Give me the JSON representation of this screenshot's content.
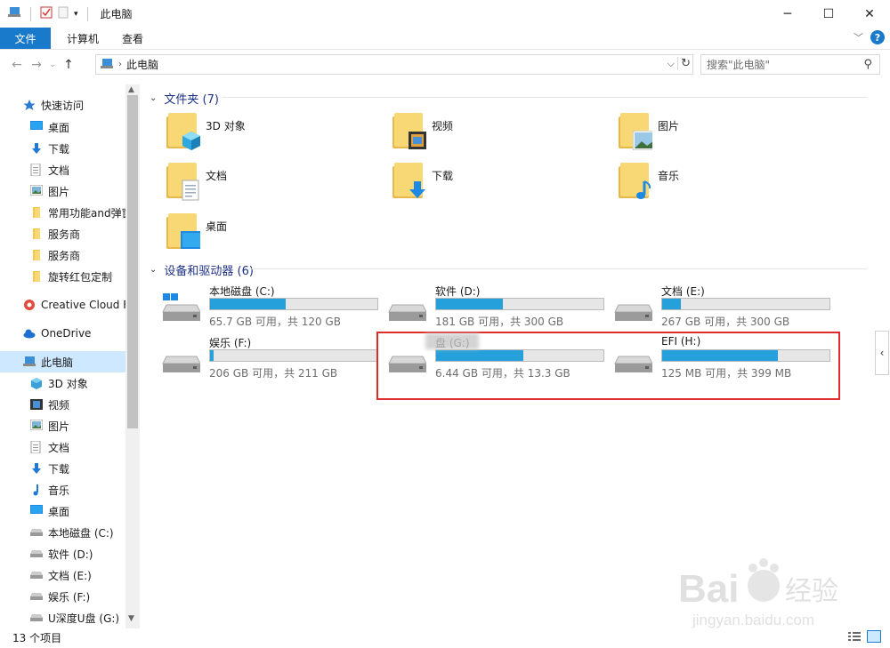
{
  "window": {
    "title": "此电脑",
    "controls": {
      "minimize": "─",
      "maximize": "☐",
      "close": "✕"
    }
  },
  "ribbon": {
    "tabs": [
      "文件",
      "计算机",
      "查看"
    ],
    "help": "?"
  },
  "address": {
    "path": "此电脑",
    "search_placeholder": "搜索\"此电脑\""
  },
  "nav": {
    "quick_access": "快速访问",
    "items": [
      {
        "label": "桌面",
        "icon": "desktop-icon",
        "pinned": true
      },
      {
        "label": "下载",
        "icon": "download-icon",
        "pinned": true
      },
      {
        "label": "文档",
        "icon": "document-icon",
        "pinned": true
      },
      {
        "label": "图片",
        "icon": "pictures-icon",
        "pinned": true
      },
      {
        "label": "常用功能and弹窗",
        "icon": "folder-icon"
      },
      {
        "label": "服务商",
        "icon": "folder-icon"
      },
      {
        "label": "服务商",
        "icon": "folder-icon"
      },
      {
        "label": "旋转红包定制",
        "icon": "folder-icon"
      }
    ],
    "creative_cloud": "Creative Cloud F",
    "onedrive": "OneDrive",
    "this_pc": "此电脑",
    "pc_items": [
      {
        "label": "3D 对象",
        "icon": "3d-objects-icon"
      },
      {
        "label": "视频",
        "icon": "video-icon"
      },
      {
        "label": "图片",
        "icon": "pictures-icon"
      },
      {
        "label": "文档",
        "icon": "document-icon"
      },
      {
        "label": "下载",
        "icon": "download-icon"
      },
      {
        "label": "音乐",
        "icon": "music-icon"
      },
      {
        "label": "桌面",
        "icon": "desktop-icon"
      },
      {
        "label": "本地磁盘 (C:)",
        "icon": "drive-icon"
      },
      {
        "label": "软件 (D:)",
        "icon": "drive-icon"
      },
      {
        "label": "文档 (E:)",
        "icon": "drive-icon"
      },
      {
        "label": "娱乐 (F:)",
        "icon": "drive-icon"
      },
      {
        "label": "U深度U盘 (G:)",
        "icon": "drive-icon"
      }
    ]
  },
  "folders_group": {
    "header": "文件夹 (7)",
    "items": [
      {
        "label": "3D 对象",
        "icon": "3d-objects-icon"
      },
      {
        "label": "视频",
        "icon": "video-icon"
      },
      {
        "label": "图片",
        "icon": "pictures-icon"
      },
      {
        "label": "文档",
        "icon": "document-icon"
      },
      {
        "label": "下载",
        "icon": "download-icon"
      },
      {
        "label": "音乐",
        "icon": "music-icon"
      },
      {
        "label": "桌面",
        "icon": "desktop-icon"
      }
    ]
  },
  "drives_group": {
    "header": "设备和驱动器 (6)",
    "items": [
      {
        "name": "本地磁盘 (C:)",
        "size_text": "65.7 GB 可用，共 120 GB",
        "used_fraction": 0.45,
        "windows": true
      },
      {
        "name": "软件 (D:)",
        "size_text": "181 GB 可用，共 300 GB",
        "used_fraction": 0.4
      },
      {
        "name": "文档 (E:)",
        "size_text": "267 GB 可用，共 300 GB",
        "used_fraction": 0.11
      },
      {
        "name": "娱乐 (F:)",
        "size_text": "206 GB 可用，共 211 GB",
        "used_fraction": 0.02
      },
      {
        "name": "盘 (G:)",
        "size_text": "6.44 GB 可用，共 13.3 GB",
        "used_fraction": 0.52
      },
      {
        "name": "EFI (H:)",
        "size_text": "125 MB 可用，共 399 MB",
        "used_fraction": 0.69
      }
    ]
  },
  "status": {
    "item_count": "13 个项目"
  },
  "watermark": {
    "brand": "Bai",
    "brand_suffix": "经验",
    "url": "jingyan.baidu.com"
  },
  "colors": {
    "accent": "#1979ca",
    "bar_fill": "#26a0da",
    "folder": "#f8d775",
    "highlight_box": "#e02b2b"
  }
}
